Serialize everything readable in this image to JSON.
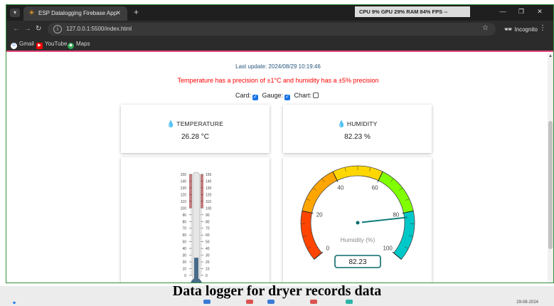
{
  "browser": {
    "tab_title": "ESP Datalogging Firebase App",
    "tab_close": "✕",
    "new_tab": "+",
    "perf_overlay": "CPU  9%   GPU 29%  RAM 84%   FPS  --",
    "url": "127.0.0.1:5500/index.html",
    "profile_label": "Incognito",
    "bookmarks": [
      "Gmail",
      "YouTube",
      "Maps"
    ]
  },
  "page": {
    "last_update": "Last update: 2024/08/29 10:19:46",
    "precision_note": "Temperature has a precision of ±1°C and humidity has a ±5% precision",
    "toggles": {
      "card": "Card:",
      "gauge": "Gauge:",
      "chart": "Chart:"
    },
    "toggle_states": {
      "card": true,
      "gauge": true,
      "chart": false
    },
    "temperature": {
      "title": "TEMPERATURE",
      "value": "26.28 °C",
      "numeric": 26.28
    },
    "humidity": {
      "title": "HUMIDITY",
      "value": "82.23 %"
    },
    "thermometer": {
      "min": 0,
      "max": 150,
      "level_max": 100,
      "tick_labels": [
        "150",
        "140",
        "130",
        "120",
        "110",
        "100",
        "90",
        "80",
        "70",
        "60",
        "50",
        "40",
        "30",
        "20",
        "10",
        "0"
      ]
    },
    "gauge": {
      "min": 0,
      "max": 100,
      "value": 82.23,
      "value_text": "82.23",
      "label": "Humidity (%)",
      "tick_labels": [
        "0",
        "20",
        "40",
        "60",
        "80",
        "100"
      ],
      "bands": [
        {
          "from": 0,
          "to": 20,
          "color": "#ff4500"
        },
        {
          "from": 20,
          "to": 40,
          "color": "#ffa500"
        },
        {
          "from": 40,
          "to": 60,
          "color": "#ffd700"
        },
        {
          "from": 60,
          "to": 80,
          "color": "#7fff00"
        },
        {
          "from": 80,
          "to": 100,
          "color": "#00c8c8"
        }
      ]
    }
  },
  "caption": "Data logger for dryer records data",
  "taskbar": {
    "date": "29-08-2024"
  },
  "colors": {
    "accent_pink": "#e8467c",
    "update_text": "#28557a",
    "precision_text": "#ff0000",
    "humidity_drop": "#1e88e5",
    "temperature_drop": "#f5c518",
    "gauge_value_box": "#0a6a6a"
  },
  "icons": {
    "tab_favicon": "sun-icon",
    "humidity": "water-drop-icon",
    "temperature": "water-drop-icon",
    "incognito": "incognito-icon",
    "address_info": "info-icon"
  }
}
